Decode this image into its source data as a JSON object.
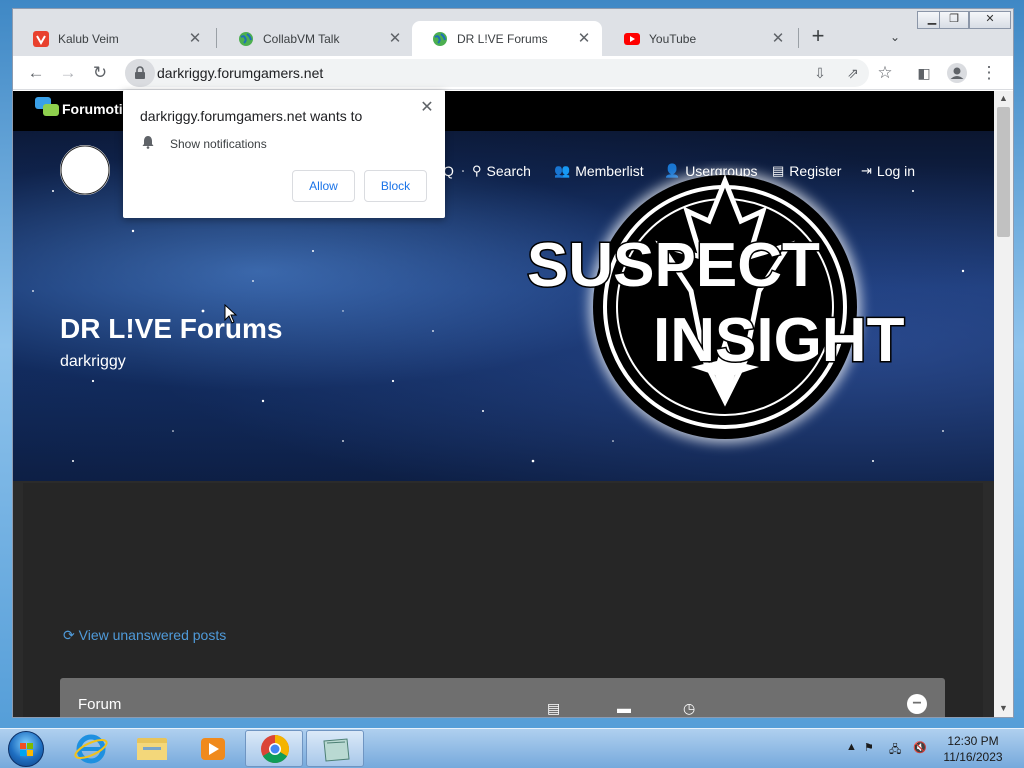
{
  "browser": {
    "tabs": [
      {
        "label": "Kalub Veim",
        "icon": "vivaldi-red-icon",
        "active": false
      },
      {
        "label": "CollabVM Talk",
        "icon": "globe-icon",
        "active": false
      },
      {
        "label": "DR L!VE Forums",
        "icon": "globe-icon",
        "active": true
      },
      {
        "label": "YouTube",
        "icon": "youtube-icon",
        "active": false
      }
    ],
    "new_tab": "+",
    "close_glyph": "✕",
    "url": "darkriggy.forumgamers.net"
  },
  "notification": {
    "title": "darkriggy.forumgamers.net wants to",
    "permission": "Show notifications",
    "allow": "Allow",
    "block": "Block"
  },
  "page": {
    "forumotion_label": "Forumotic",
    "nav": [
      {
        "label": "Q",
        "icon": "faq-icon"
      },
      {
        "label": "Search",
        "icon": "search-icon"
      },
      {
        "label": "Memberlist",
        "icon": "members-icon"
      },
      {
        "label": "Usergroups",
        "icon": "usergroups-icon"
      },
      {
        "label": "Register",
        "icon": "register-icon"
      },
      {
        "label": "Log in",
        "icon": "login-icon"
      }
    ],
    "site_title": "DR L!VE Forums",
    "site_description": "darkriggy",
    "emblem_text": {
      "line1": "SUSPECT",
      "line2": "INSIGHT"
    },
    "unanswered_link": "View unanswered posts",
    "forum_header": "Forum"
  },
  "taskbar": {
    "apps": [
      "start-orb",
      "internet-explorer",
      "file-explorer",
      "media-player",
      "chrome",
      "unknown-app"
    ],
    "clock_time": "12:30 PM",
    "clock_date": "11/16/2023"
  }
}
